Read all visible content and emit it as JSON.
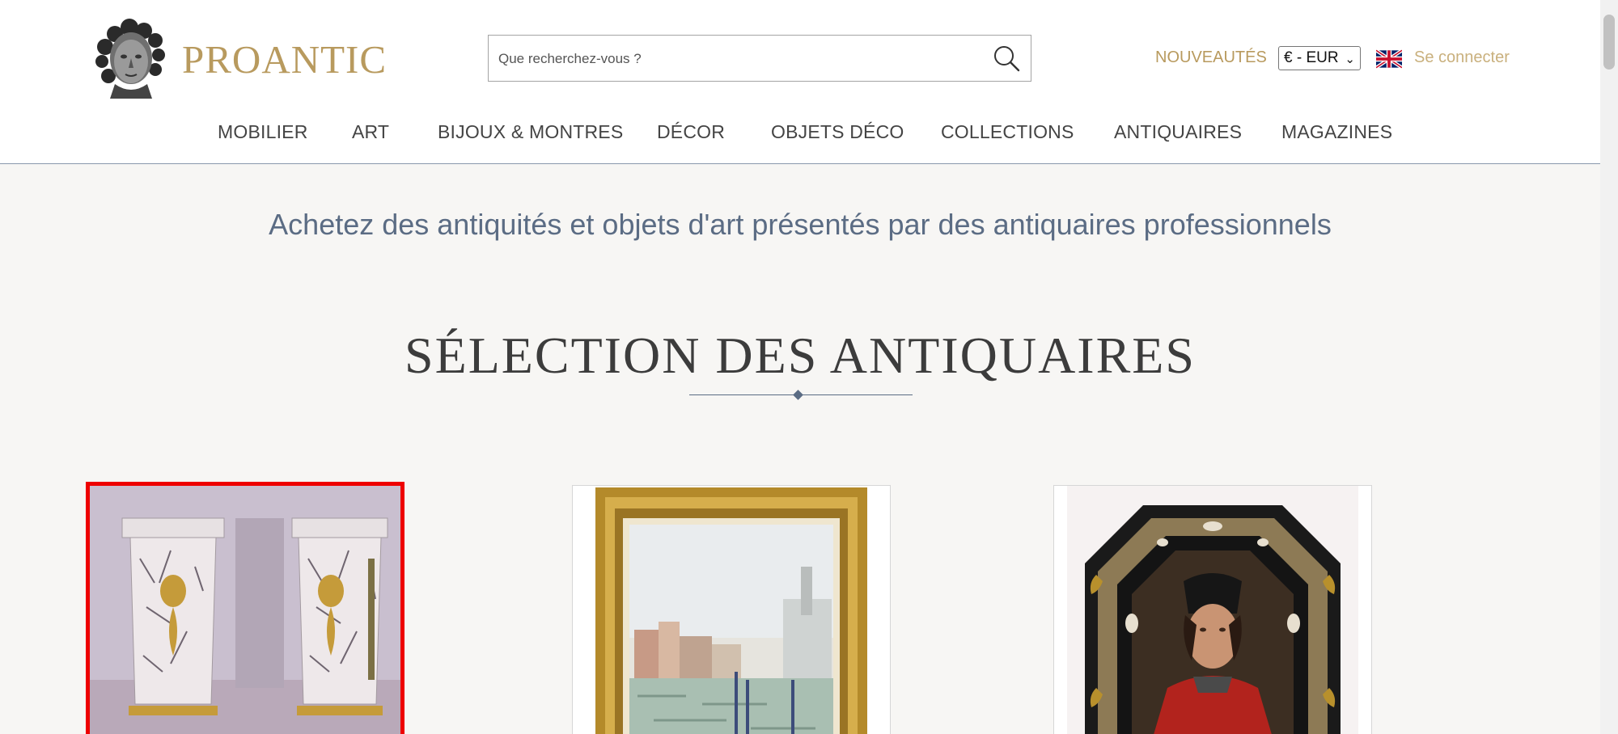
{
  "header": {
    "logo_text": "PROANTIC",
    "search": {
      "placeholder": "Que recherchez-vous ?",
      "value": ""
    },
    "nouveautes_label": "NOUVEAUTÉS",
    "currency": "€ - EUR",
    "language_flag": "uk-flag-icon",
    "login_label": "Se connecter"
  },
  "nav": {
    "items": [
      {
        "label": "MOBILIER"
      },
      {
        "label": "ART"
      },
      {
        "label": "BIJOUX & MONTRES"
      },
      {
        "label": "DÉCOR"
      },
      {
        "label": "OBJETS DÉCO"
      },
      {
        "label": "COLLECTIONS"
      },
      {
        "label": "ANTIQUAIRES"
      },
      {
        "label": "MAGAZINES"
      }
    ]
  },
  "main": {
    "tagline": "Achetez des antiquités et objets d'art présentés par des antiquaires professionnels",
    "section_title": "SÉLECTION DES ANTIQUAIRES",
    "products": [
      {
        "image": "marble-pedestals-image",
        "selected": true
      },
      {
        "image": "venice-painting-image",
        "selected": false
      },
      {
        "image": "octagonal-portrait-image",
        "selected": false
      }
    ]
  },
  "colors": {
    "brand_gold": "#b89a5e",
    "accent_blue": "#5b6c84",
    "selection_red": "#ee0000",
    "background": "#f7f6f4"
  }
}
